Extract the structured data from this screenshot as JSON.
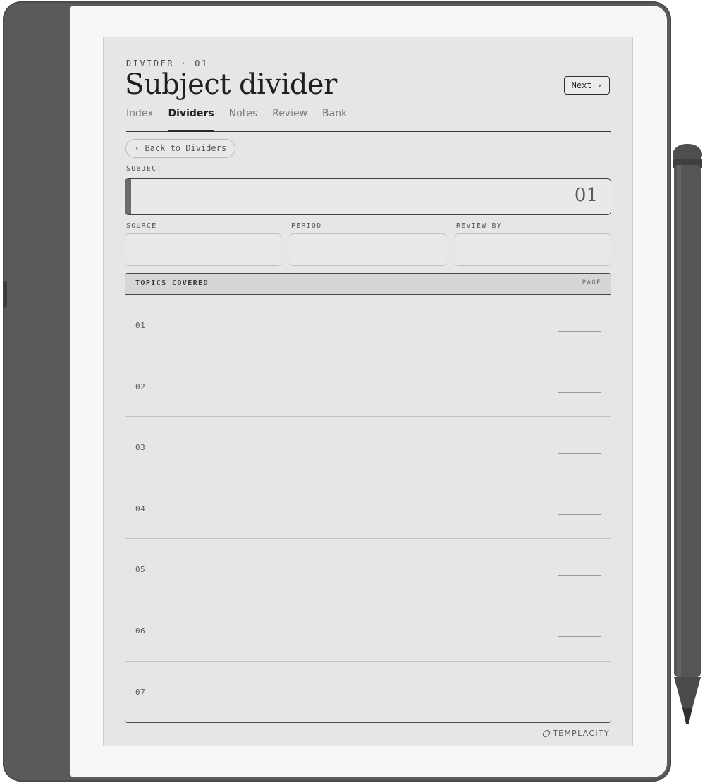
{
  "header": {
    "eyebrow": "DIVIDER · 01",
    "title": "Subject divider",
    "next_label": "Next ›"
  },
  "tabs": [
    {
      "label": "Index",
      "active": false
    },
    {
      "label": "Dividers",
      "active": true
    },
    {
      "label": "Notes",
      "active": false
    },
    {
      "label": "Review",
      "active": false
    },
    {
      "label": "Bank",
      "active": false
    }
  ],
  "back_label": "‹ Back to Dividers",
  "subject": {
    "label": "SUBJECT",
    "number": "01"
  },
  "fields": [
    {
      "label": "SOURCE"
    },
    {
      "label": "PERIOD"
    },
    {
      "label": "REVIEW BY"
    }
  ],
  "topics": {
    "header_left": "TOPICS COVERED",
    "header_right": "PAGE",
    "rows": [
      "01",
      "02",
      "03",
      "04",
      "05",
      "06",
      "07"
    ]
  },
  "brand": {
    "name": "TEMPLACITY",
    "icon": "templacity-logo-icon"
  },
  "colors": {
    "device_body": "#5a5a5a",
    "screen_bg": "#e6e6e6",
    "ink": "#2a2a2a"
  }
}
